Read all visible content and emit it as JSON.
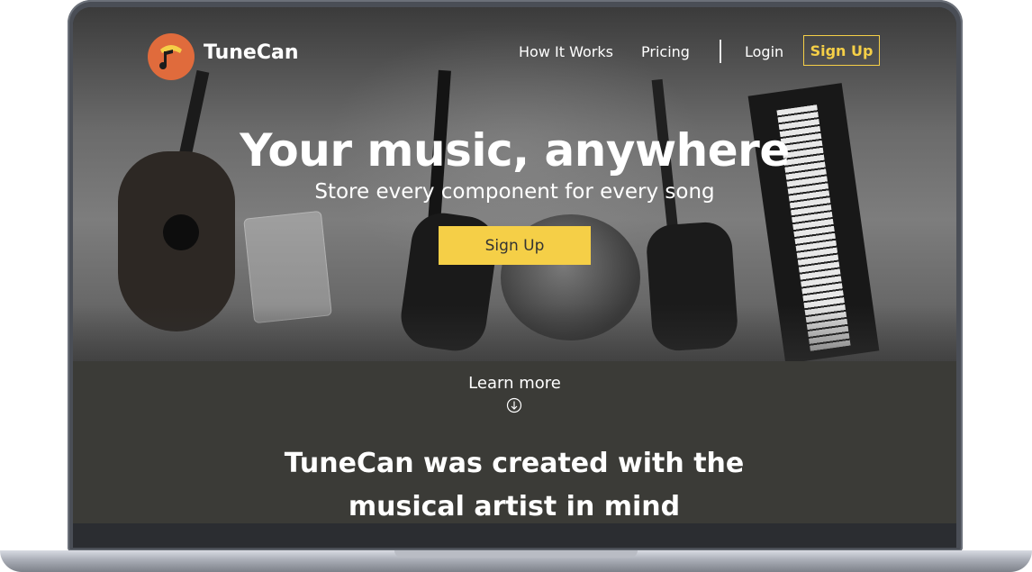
{
  "colors": {
    "accent": "#f5cf47",
    "logo": "#e06b3c",
    "dark_section": "#3b3b37"
  },
  "header": {
    "brand": "TuneCan",
    "logo_icon": "music-note-can-icon",
    "nav": {
      "how_it_works": "How It Works",
      "pricing": "Pricing",
      "login": "Login",
      "signup": "Sign Up"
    }
  },
  "hero": {
    "title": "Your music, anywhere",
    "subtitle": "Store every component for every song",
    "cta": "Sign Up"
  },
  "learn_more": {
    "label": "Learn more",
    "icon": "arrow-down-circle-icon"
  },
  "about": {
    "line1": "TuneCan was created with the",
    "line2": "musical artist in mind"
  }
}
